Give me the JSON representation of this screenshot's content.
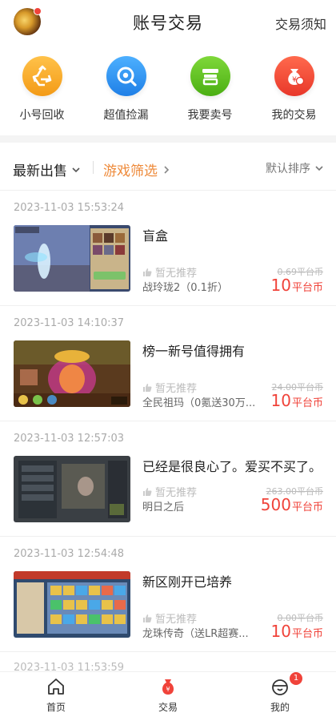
{
  "header": {
    "title": "账号交易",
    "notice_link": "交易须知",
    "avatar_badge": true
  },
  "quick_menu": [
    {
      "label": "小号回收",
      "icon": "recycle-icon",
      "color": "#f5a623"
    },
    {
      "label": "超值捡漏",
      "icon": "magnifier-icon",
      "color": "#2f8ff0"
    },
    {
      "label": "我要卖号",
      "icon": "sell-icon",
      "color": "#5cc11d"
    },
    {
      "label": "我的交易",
      "icon": "money-bag-icon",
      "color": "#f04a3a"
    }
  ],
  "filters": {
    "latest": "最新出售",
    "game_filter": "游戏筛选",
    "sort": "默认排序"
  },
  "listings": [
    {
      "date": "2023-11-03 15:53:24",
      "name": "盲盒",
      "recommend": "暂无推荐",
      "game": "战玲珑2（0.1折）",
      "original_price": "0.69平台币",
      "price": "10",
      "price_unit": "平台币"
    },
    {
      "date": "2023-11-03 14:10:37",
      "name": "榜一新号值得拥有",
      "recommend": "暂无推荐",
      "game": "全民祖玛（0氪送30万...",
      "original_price": "24.00平台币",
      "price": "10",
      "price_unit": "平台币"
    },
    {
      "date": "2023-11-03 12:57:03",
      "name": "已经是很良心了。爱买不买了。",
      "recommend": "暂无推荐",
      "game": "明日之后",
      "original_price": "263.00平台币",
      "price": "500",
      "price_unit": "平台币"
    },
    {
      "date": "2023-11-03 12:54:48",
      "name": "新区刚开已培养",
      "recommend": "暂无推荐",
      "game": "龙珠传奇（送LR超赛...",
      "original_price": "0.00平台币",
      "price": "10",
      "price_unit": "平台币"
    }
  ],
  "partial_next_date": "2023-11-03 11:53:59",
  "bottom_nav": [
    {
      "label": "首页",
      "icon": "home-icon",
      "active": false
    },
    {
      "label": "交易",
      "icon": "trade-bag-icon",
      "active": true
    },
    {
      "label": "我的",
      "icon": "profile-icon",
      "active": false,
      "badge": "1"
    }
  ]
}
